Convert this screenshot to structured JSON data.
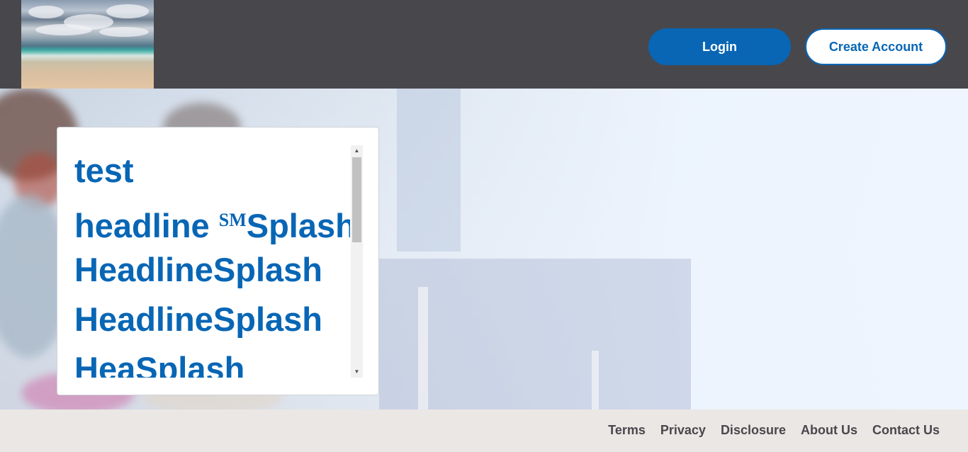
{
  "header": {
    "logo_image": "beach-photo",
    "login_label": "Login",
    "create_account_label": "Create Account"
  },
  "panel": {
    "headlines": [
      {
        "text": "test",
        "sm": "",
        "after": ""
      },
      {
        "text": "headline ",
        "sm": "SM",
        "after": "Splash"
      },
      {
        "text": "HeadlineSplash",
        "sm": "",
        "after": ""
      },
      {
        "text": "HeadlineSplash",
        "sm": "",
        "after": ""
      },
      {
        "text": "HeaSplash",
        "sm": "",
        "after": ""
      }
    ]
  },
  "footer": {
    "links": [
      "Terms",
      "Privacy",
      "Disclosure",
      "About Us",
      "Contact Us"
    ]
  },
  "colors": {
    "header_bg": "#48474c",
    "brand_blue": "#0866b5",
    "footer_bg": "#ebe7e5",
    "footer_text": "#48474c"
  }
}
